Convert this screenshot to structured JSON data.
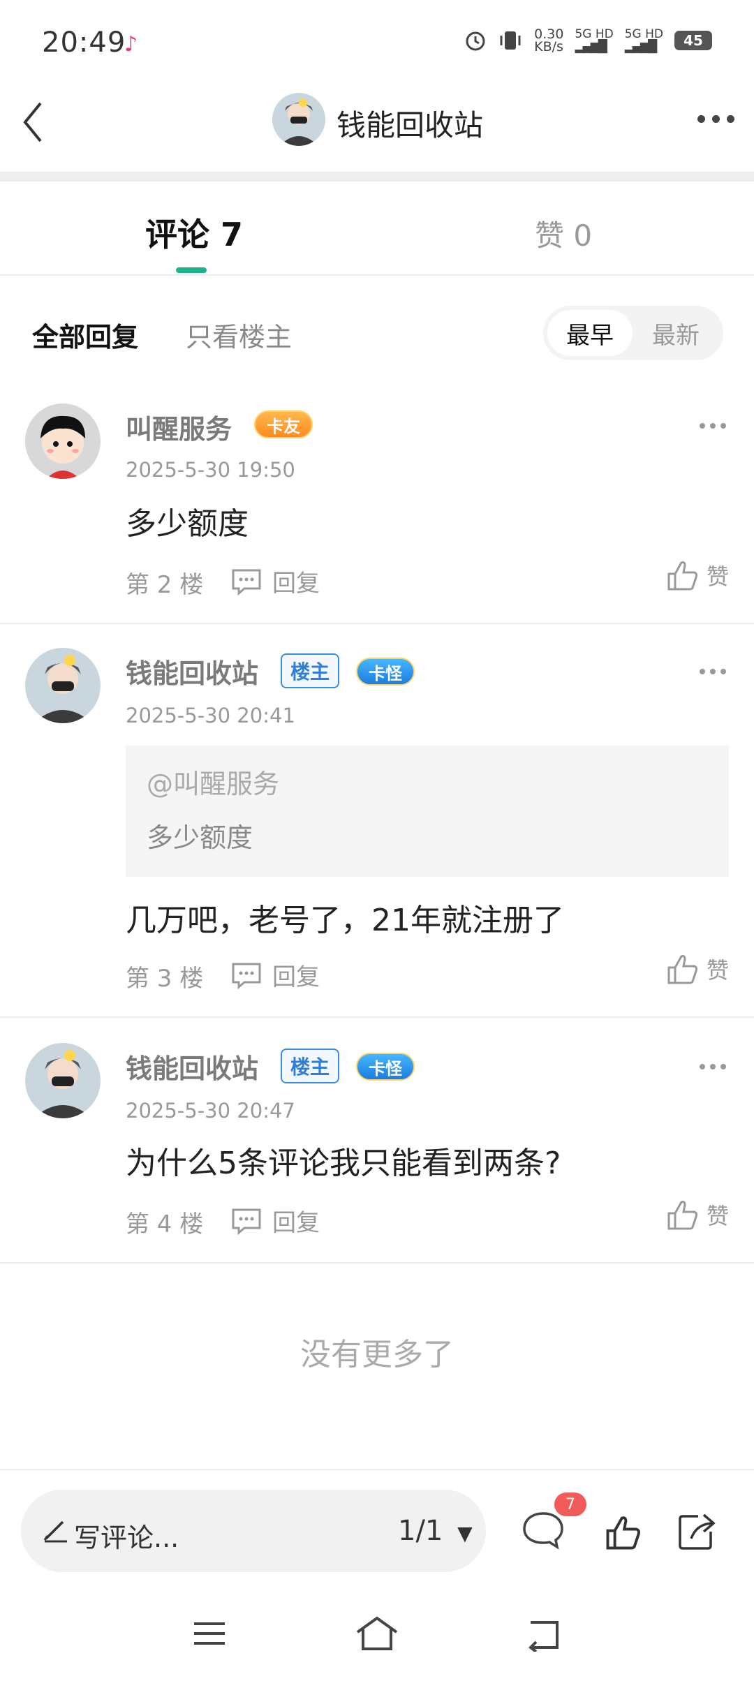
{
  "status_bar": {
    "time": "20:49",
    "net_speed": "0.30\nKB/s",
    "net_speed_value": "0.30",
    "net_speed_unit": "KB/s",
    "sim1": "5G HD",
    "sim2": "5G HD",
    "battery": "45"
  },
  "header": {
    "title": "钱能回收站",
    "icons": [
      "back-arrow-icon",
      "more-icon"
    ]
  },
  "tabs": [
    {
      "label": "评论 7",
      "active": true
    },
    {
      "label": "赞 0",
      "active": false
    }
  ],
  "filter": {
    "all": "全部回复",
    "op_only": "只看楼主",
    "sort": [
      "最早",
      "最新"
    ],
    "sort_selected": "最早"
  },
  "comments": [
    {
      "user": "叫醒服务",
      "badges": [
        "卡友"
      ],
      "time": "2025-5-30 19:50",
      "text": "多少额度",
      "floor": "第 2 楼",
      "reply": "回复",
      "like": "赞"
    },
    {
      "user": "钱能回收站",
      "badges": [
        "楼主",
        "卡怪"
      ],
      "time": "2025-5-30 20:41",
      "quote_at": "@叫醒服务",
      "quote_text": "多少额度",
      "text": "几万吧，老号了，21年就注册了",
      "floor": "第 3 楼",
      "reply": "回复",
      "like": "赞"
    },
    {
      "user": "钱能回收站",
      "badges": [
        "楼主",
        "卡怪"
      ],
      "time": "2025-5-30 20:47",
      "text": "为什么5条评论我只能看到两条?",
      "floor": "第 4 楼",
      "reply": "回复",
      "like": "赞"
    }
  ],
  "end_text": "没有更多了",
  "bottom_bar": {
    "placeholder": "写评论...",
    "pager": "1/1",
    "comment_count": "7"
  },
  "colors": {
    "accent": "#1fb38b",
    "badge_blue": "#2f7fd8",
    "badge_red": "#f25a5a"
  }
}
